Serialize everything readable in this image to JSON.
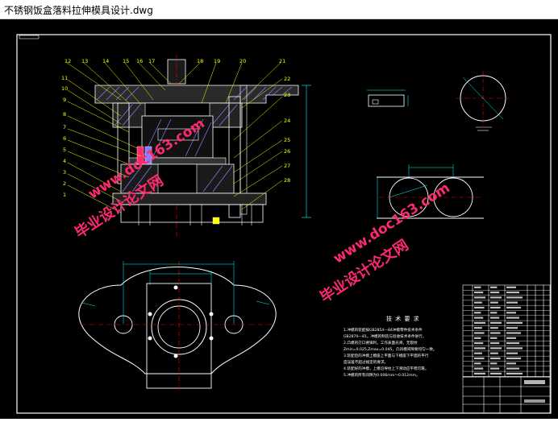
{
  "window": {
    "title": "不锈钢饭盒落料拉伸模具设计.dwg"
  },
  "drawing": {
    "watermark_site": "毕业设计论文网",
    "watermark_url": "www.doc163.com",
    "part_numbers_left": [
      "12",
      "13",
      "14",
      "15",
      "16",
      "17",
      "18",
      "19",
      "20",
      "21",
      "11",
      "10",
      "9",
      "8",
      "7",
      "6",
      "5",
      "4",
      "3",
      "2",
      "1"
    ],
    "part_numbers_right": [
      "22",
      "23",
      "24",
      "25",
      "26",
      "27",
      "28"
    ],
    "tech_title": "技 术 要 求",
    "tech_lines": [
      "1.冲模的装配按GB2854—84冲模零件技术条件",
      "GB2870—81。冲模的制造与验收技术条件进行。",
      "2.凸模的刃口要锋利，工作表面光滑，无裂纹",
      "Zmin=0.025,Zmax=0.045，凸凹模间隙要均匀一致。",
      "3.装配后的冲模上模座上平面与下模座下平面的平行",
      "度误差不超过规定的要求。",
      "4.装配好的冲模，上模沿导柱上下滑动应平稳可靠。",
      "5.冲模的所有间隙为0.006mm～0.012mm。"
    ]
  },
  "colors": {
    "background": "#000000",
    "outline": "#ffffff",
    "dimension": "#00ffff",
    "center": "#ff0000",
    "leader": "#ffff00",
    "section": "#8b7cff",
    "watermark": "#ff2a6d",
    "frame": "#ffffff"
  }
}
